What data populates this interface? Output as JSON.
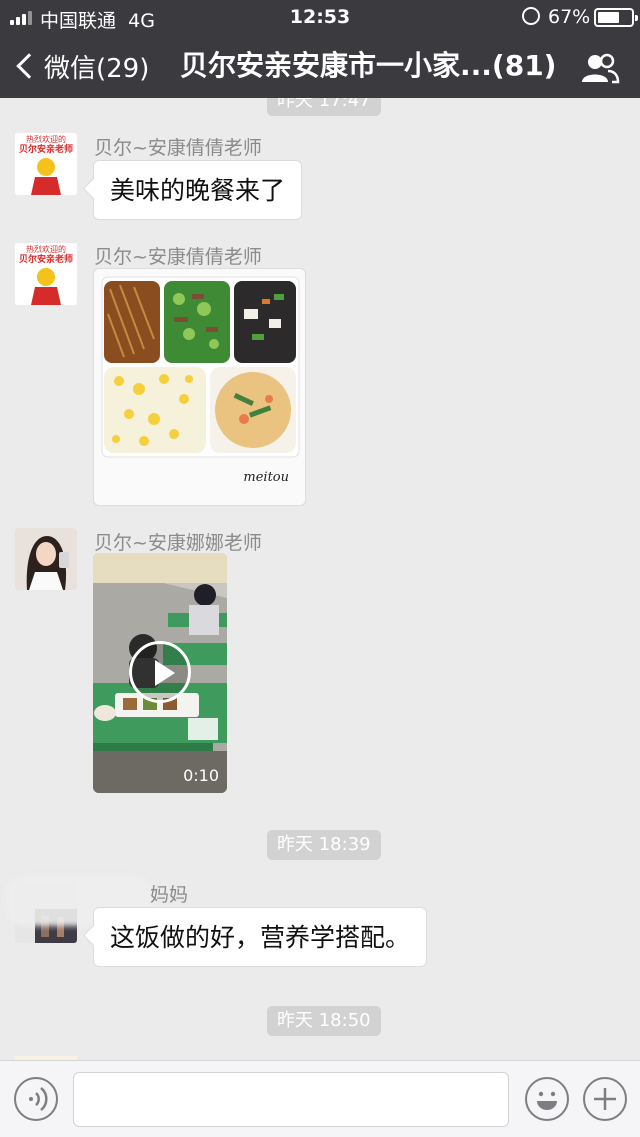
{
  "status_bar": {
    "carrier": "中国联通",
    "network": "4G",
    "time": "12:53",
    "battery_percent": "67%",
    "battery_level": 0.67
  },
  "nav": {
    "back_label": "微信(29)",
    "title": "贝尔安亲安康市一小家...(81)",
    "group_icon": "group-members-icon"
  },
  "chat": {
    "timestamps": [
      "昨天 17:47",
      "昨天 18:39",
      "昨天 18:50"
    ],
    "messages": [
      {
        "sender": "贝尔~安康倩倩老师",
        "type": "text",
        "text": "美味的晚餐来了"
      },
      {
        "sender": "贝尔~安康倩倩老师",
        "type": "image",
        "image_caption": "meitou"
      },
      {
        "sender": "贝尔~安康娜娜老师",
        "type": "video",
        "duration": "0:10"
      },
      {
        "sender": "妈妈",
        "type": "text",
        "text": "这饭做的好，营养学搭配。"
      }
    ],
    "avatar_badge_top": "热烈欢迎的",
    "avatar_badge_bottom": "贝尔安亲老师"
  },
  "input_bar": {
    "voice_icon": "voice-icon",
    "emoji_icon": "emoji-icon",
    "plus_icon": "plus-icon"
  },
  "colors": {
    "nav_bg": "#3a3a3f",
    "chat_bg": "#ebebeb",
    "bubble_bg": "#ffffff",
    "timestamp_bg": "#d2d2d2"
  }
}
